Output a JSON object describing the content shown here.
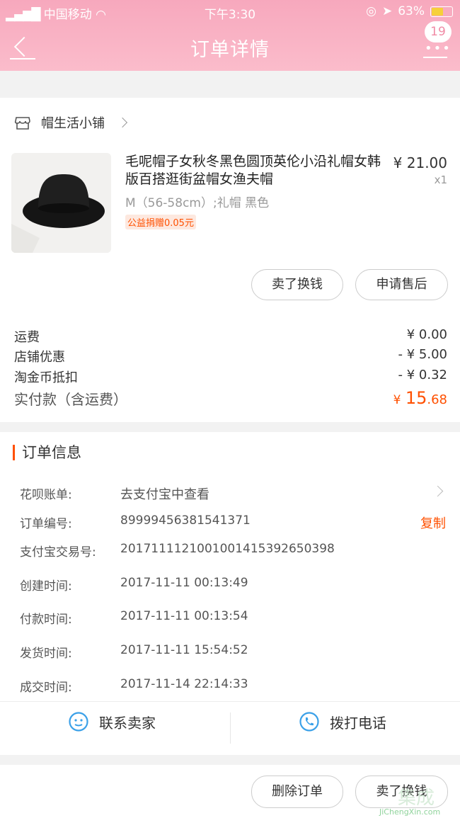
{
  "status": {
    "carrier": "中国移动",
    "time": "下午3:30",
    "battery": "63%",
    "battery_fraction": 0.63
  },
  "nav": {
    "title": "订单详情",
    "badge": "19"
  },
  "shop": {
    "name": "帽生活小铺"
  },
  "product": {
    "title": "毛呢帽子女秋冬黑色圆顶英伦小沿礼帽女韩版百搭逛街盆帽女渔夫帽",
    "price": "¥ 21.00",
    "qty": "x1",
    "spec": "M（56-58cm）;礼帽 黑色",
    "tag": "公益捐赠0.05元"
  },
  "actions": {
    "sell": "卖了换钱",
    "after_sale": "申请售后"
  },
  "fees": [
    {
      "label": "运费",
      "value": "¥ 0.00"
    },
    {
      "label": "店铺优惠",
      "value": "- ¥ 5.00"
    },
    {
      "label": "淘金币抵扣",
      "value": "- ¥ 0.32"
    }
  ],
  "total": {
    "label": "实付款（含运费）",
    "currency": "¥",
    "int": "15",
    "dec": ".68"
  },
  "order_info": {
    "title": "订单信息",
    "huabei": {
      "k": "花呗账单:",
      "v": "去支付宝中查看"
    },
    "order_no": {
      "k": "订单编号:",
      "v": "89999456381541371",
      "copy": "复制"
    },
    "alipay_no": {
      "k": "支付宝交易号:",
      "v": "2017111121001001415392650398"
    },
    "created": {
      "k": "创建时间:",
      "v": "2017-11-11 00:13:49"
    },
    "paid": {
      "k": "付款时间:",
      "v": "2017-11-11 00:13:54"
    },
    "shipped": {
      "k": "发货时间:",
      "v": "2017-11-11 15:54:52"
    },
    "done": {
      "k": "成交时间:",
      "v": "2017-11-14 22:14:33"
    }
  },
  "contact": {
    "seller": "联系卖家",
    "call": "拨打电话"
  },
  "bottom": {
    "delete": "删除订单",
    "sell": "卖了换钱"
  },
  "watermark": {
    "big": "集成",
    "small": "JiChengXin.com"
  },
  "colors": {
    "header": "#f7a8bd",
    "accent": "#ff5000",
    "icon_blue": "#3aa0e8"
  }
}
